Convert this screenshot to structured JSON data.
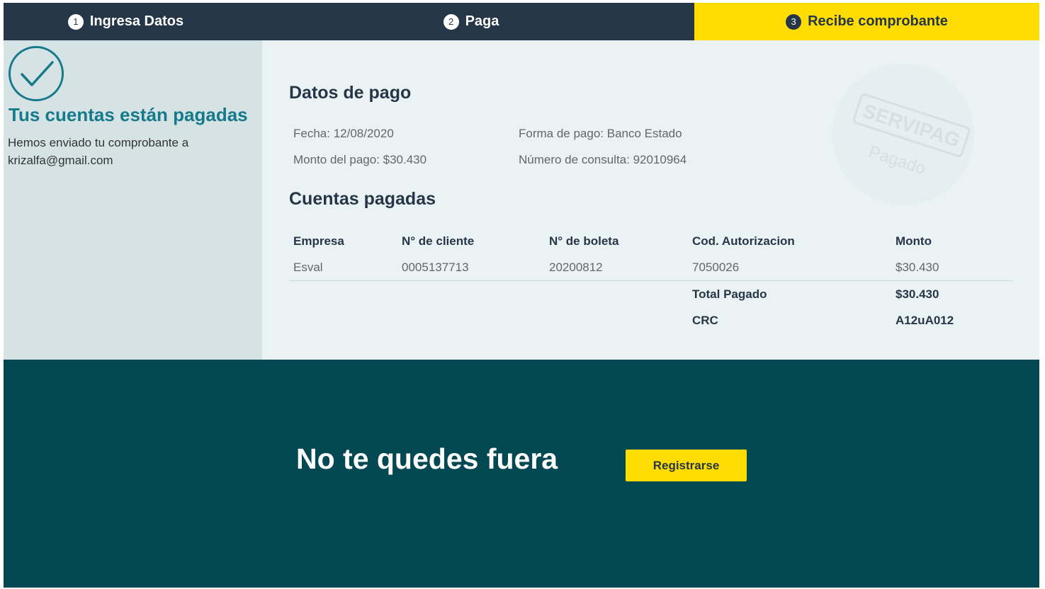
{
  "steps": [
    {
      "number": "1",
      "label": "Ingresa Datos"
    },
    {
      "number": "2",
      "label": "Paga"
    },
    {
      "number": "3",
      "label": "Recibe comprobante"
    }
  ],
  "confirmation": {
    "title": "Tus cuentas están pagadas",
    "message": "Hemos enviado tu comprobante a krizalfa@gmail.com"
  },
  "payment": {
    "section_title": "Datos de pago",
    "date": "Fecha: 12/08/2020",
    "method": "Forma de pago: Banco Estado",
    "amount": "Monto del pago: $30.430",
    "query_number": "Número de consulta: 92010964"
  },
  "stamp": {
    "brand": "SERVIPAG",
    "status": "Pagado"
  },
  "accounts": {
    "section_title": "Cuentas pagadas",
    "headers": [
      "Empresa",
      "N° de cliente",
      "N° de boleta",
      "Cod. Autorizacion",
      "Monto"
    ],
    "rows": [
      [
        "Esval",
        "0005137713",
        "20200812",
        "7050026",
        "$30.430"
      ]
    ],
    "total_label": "Total Pagado",
    "total_value": "$30.430",
    "crc_label": "CRC",
    "crc_value": "A12uA012"
  },
  "banner": {
    "title": "No te quedes fuera",
    "button_label": "Registrarse"
  },
  "colors": {
    "nav_dark": "#253648",
    "accent_yellow": "#ffdd00",
    "teal_text": "#167a8b",
    "banner_bg": "#044853"
  }
}
